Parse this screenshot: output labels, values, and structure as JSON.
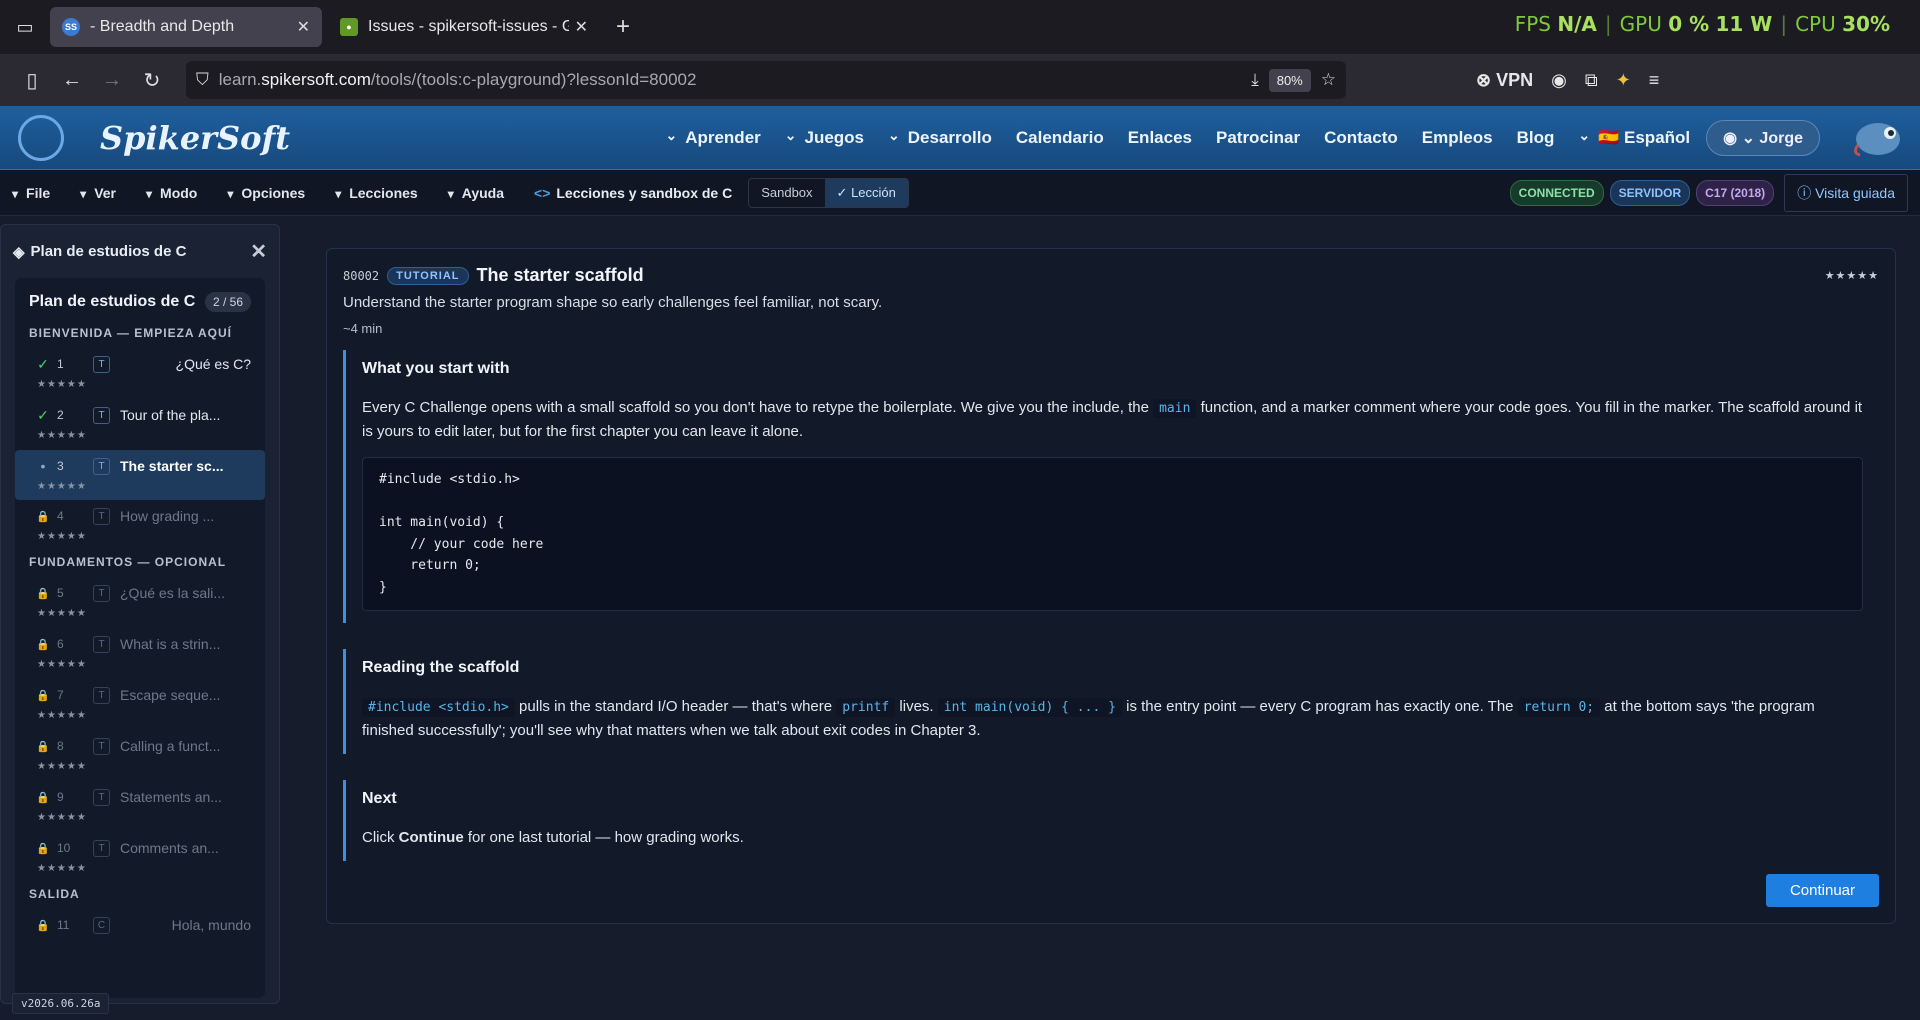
{
  "browser": {
    "tabs": [
      {
        "title": " - Breadth and Depth",
        "active": true,
        "favicon_text": "SS"
      },
      {
        "title": "Issues - spikersoft-issues - Gitea",
        "active": false,
        "favicon_text": ""
      }
    ],
    "url_prefix": "learn.",
    "url_domain": "spikersoft.com",
    "url_path": "/tools/(tools:c-playground)?lessonId=80002",
    "zoom": "80%",
    "vpn_label": "VPN"
  },
  "overlay": {
    "fps_label": "FPS",
    "fps_value": "N/A",
    "gpu_label": "GPU",
    "gpu_value": "0 %",
    "gpu_watts": "11 W",
    "cpu_label": "CPU",
    "cpu_value": "30%"
  },
  "site": {
    "logo": "SpikerSoft",
    "nav": [
      {
        "label": "Aprender",
        "dropdown": true
      },
      {
        "label": "Juegos",
        "dropdown": true
      },
      {
        "label": "Desarrollo",
        "dropdown": true
      },
      {
        "label": "Calendario",
        "dropdown": false
      },
      {
        "label": "Enlaces",
        "dropdown": false
      },
      {
        "label": "Patrocinar",
        "dropdown": false
      },
      {
        "label": "Contacto",
        "dropdown": false
      },
      {
        "label": "Empleos",
        "dropdown": false
      },
      {
        "label": "Blog",
        "dropdown": false
      },
      {
        "label": "🇪🇸 Español",
        "dropdown": true
      }
    ],
    "user": "Jorge"
  },
  "toolbar": {
    "menus": [
      "File",
      "Ver",
      "Modo",
      "Opciones",
      "Lecciones",
      "Ayuda"
    ],
    "breadcrumb": "Lecciones y sandbox de C",
    "mode_sandbox": "Sandbox",
    "mode_lesson": "Lección",
    "badges": {
      "connected": "CONNECTED",
      "server": "SERVIDOR",
      "std": "C17 (2018)"
    },
    "guide": "Visita guiada"
  },
  "sidebar": {
    "header": "Plan de estudios de C",
    "title": "Plan de estudios de C",
    "count": "2 / 56",
    "sections": [
      {
        "name": "BIENVENIDA — EMPIEZA AQUÍ",
        "lessons": [
          {
            "num": "1",
            "type": "T",
            "name": "¿Qué es C?",
            "status": "done",
            "stars": "★★★★★"
          },
          {
            "num": "2",
            "type": "T",
            "name": "Tour of the pla...",
            "status": "done",
            "stars": "★★★★★"
          },
          {
            "num": "3",
            "type": "T",
            "name": "The starter sc...",
            "status": "current",
            "stars": "★★★★★"
          },
          {
            "num": "4",
            "type": "T",
            "name": "How grading ...",
            "status": "locked",
            "stars": "★★★★★"
          }
        ]
      },
      {
        "name": "FUNDAMENTOS — OPCIONAL",
        "lessons": [
          {
            "num": "5",
            "type": "T",
            "name": "¿Qué es la sali...",
            "status": "locked",
            "stars": "★★★★★"
          },
          {
            "num": "6",
            "type": "T",
            "name": "What is a strin...",
            "status": "locked",
            "stars": "★★★★★"
          },
          {
            "num": "7",
            "type": "T",
            "name": "Escape seque...",
            "status": "locked",
            "stars": "★★★★★"
          },
          {
            "num": "8",
            "type": "T",
            "name": "Calling a funct...",
            "status": "locked",
            "stars": "★★★★★"
          },
          {
            "num": "9",
            "type": "T",
            "name": "Statements an...",
            "status": "locked",
            "stars": "★★★★★"
          },
          {
            "num": "10",
            "type": "T",
            "name": "Comments an...",
            "status": "locked",
            "stars": "★★★★★"
          }
        ]
      },
      {
        "name": "SALIDA",
        "lessons": [
          {
            "num": "11",
            "type": "C",
            "name": "Hola, mundo",
            "status": "locked",
            "stars": ""
          }
        ]
      }
    ],
    "version": "v2026.06.26a"
  },
  "lesson": {
    "id": "80002",
    "tag": "TUTORIAL",
    "title": "The starter scaffold",
    "stars": "★★★★★",
    "subtitle": "Understand the starter program shape so early challenges feel familiar, not scary.",
    "time": "~4 min",
    "s1_title": "What you start with",
    "s1_p_a": "Every C Challenge opens with a small scaffold so you don't have to retype the boilerplate. We give you the include, the ",
    "s1_code": "main",
    "s1_p_b": " function, and a marker comment where your code goes. You fill in the marker. The scaffold around it is yours to edit later, but for the first chapter you can leave it alone.",
    "code_lines": [
      "#include <stdio.h>",
      "",
      "int main(void) {",
      "    // your code here",
      "    return 0;",
      "}"
    ],
    "s2_title": "Reading the scaffold",
    "s2_c1": "#include <stdio.h>",
    "s2_t1": " pulls in the standard I/O header — that's where ",
    "s2_c2": "printf",
    "s2_t2": " lives. ",
    "s2_c3": "int main(void) { ... }",
    "s2_t3": " is the entry point — every C program has exactly one. The ",
    "s2_c4": "return 0;",
    "s2_t4": " at the bottom says 'the program finished successfully'; you'll see why that matters when we talk about exit codes in Chapter 3.",
    "s3_title": "Next",
    "s3_t1": "Click ",
    "s3_bold": "Continue",
    "s3_t2": " for one last tutorial — how grading works.",
    "continue": "Continuar"
  },
  "colors": {
    "accent": "#1f7fe0",
    "header_blue": "#1f5f9e",
    "done_check": "#4cd06a"
  }
}
